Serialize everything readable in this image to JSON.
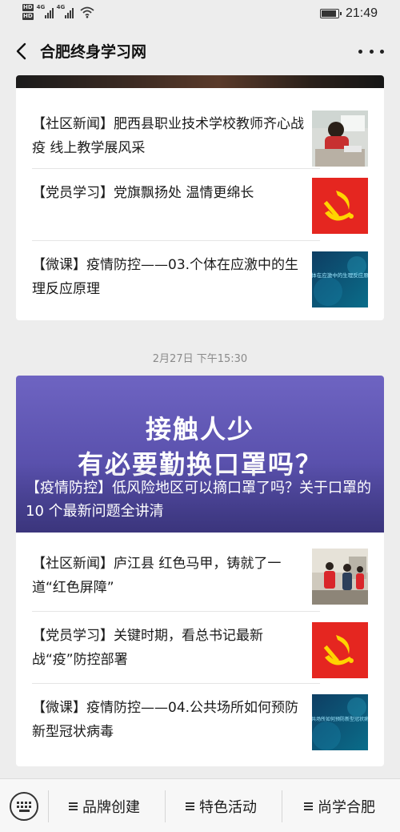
{
  "status_bar": {
    "time": "21:49",
    "network_1": "4G",
    "network_2": "4G",
    "hd_1": "HD",
    "hd_2": "HD",
    "battery_level": 0.8
  },
  "nav": {
    "title": "合肥终身学习网",
    "back_icon": "chevron-left-icon",
    "more_icon": "more-dots-icon"
  },
  "card1": {
    "items": [
      {
        "text": "【社区新闻】肥西县职业技术学校教师齐心战疫 线上教学展风采",
        "thumb": "teacher-photo"
      },
      {
        "text": "【党员学习】党旗飘扬处 温情更绵长",
        "thumb": "party-flag"
      },
      {
        "text": "【微课】疫情防控——03.个体在应激中的生理反应原理",
        "thumb": "micro-lesson-video",
        "thumb_text": "个体在应激中的生理反应原理"
      }
    ]
  },
  "date_label": "2月27日 下午15:30",
  "card2": {
    "hero": {
      "line1": "接触人少",
      "line2": "有必要勤换口罩吗？",
      "caption": "【疫情防控】低风险地区可以摘口罩了吗？关于口罩的 10 个最新问题全讲清"
    },
    "items": [
      {
        "text": "【社区新闻】庐江县 红色马甲，铸就了一道“红色屏障”",
        "thumb": "community-photo"
      },
      {
        "text": "【党员学习】关键时期，看总书记最新战“疫”防控部署",
        "thumb": "party-flag"
      },
      {
        "text": "【微课】疫情防控——04.公共场所如何预防新型冠状病毒",
        "thumb": "micro-lesson-video",
        "thumb_text": "公共场所如何预防新型冠状病毒"
      }
    ]
  },
  "tab_bar": {
    "keyboard_icon": "keyboard-icon",
    "tabs": [
      {
        "label": "品牌创建"
      },
      {
        "label": "特色活动"
      },
      {
        "label": "尚学合肥"
      }
    ]
  },
  "colors": {
    "party_red": "#e52620",
    "party_gold": "#ffd400",
    "hero_purple": "#6e64c2",
    "video_teal": "#0e3e63"
  }
}
